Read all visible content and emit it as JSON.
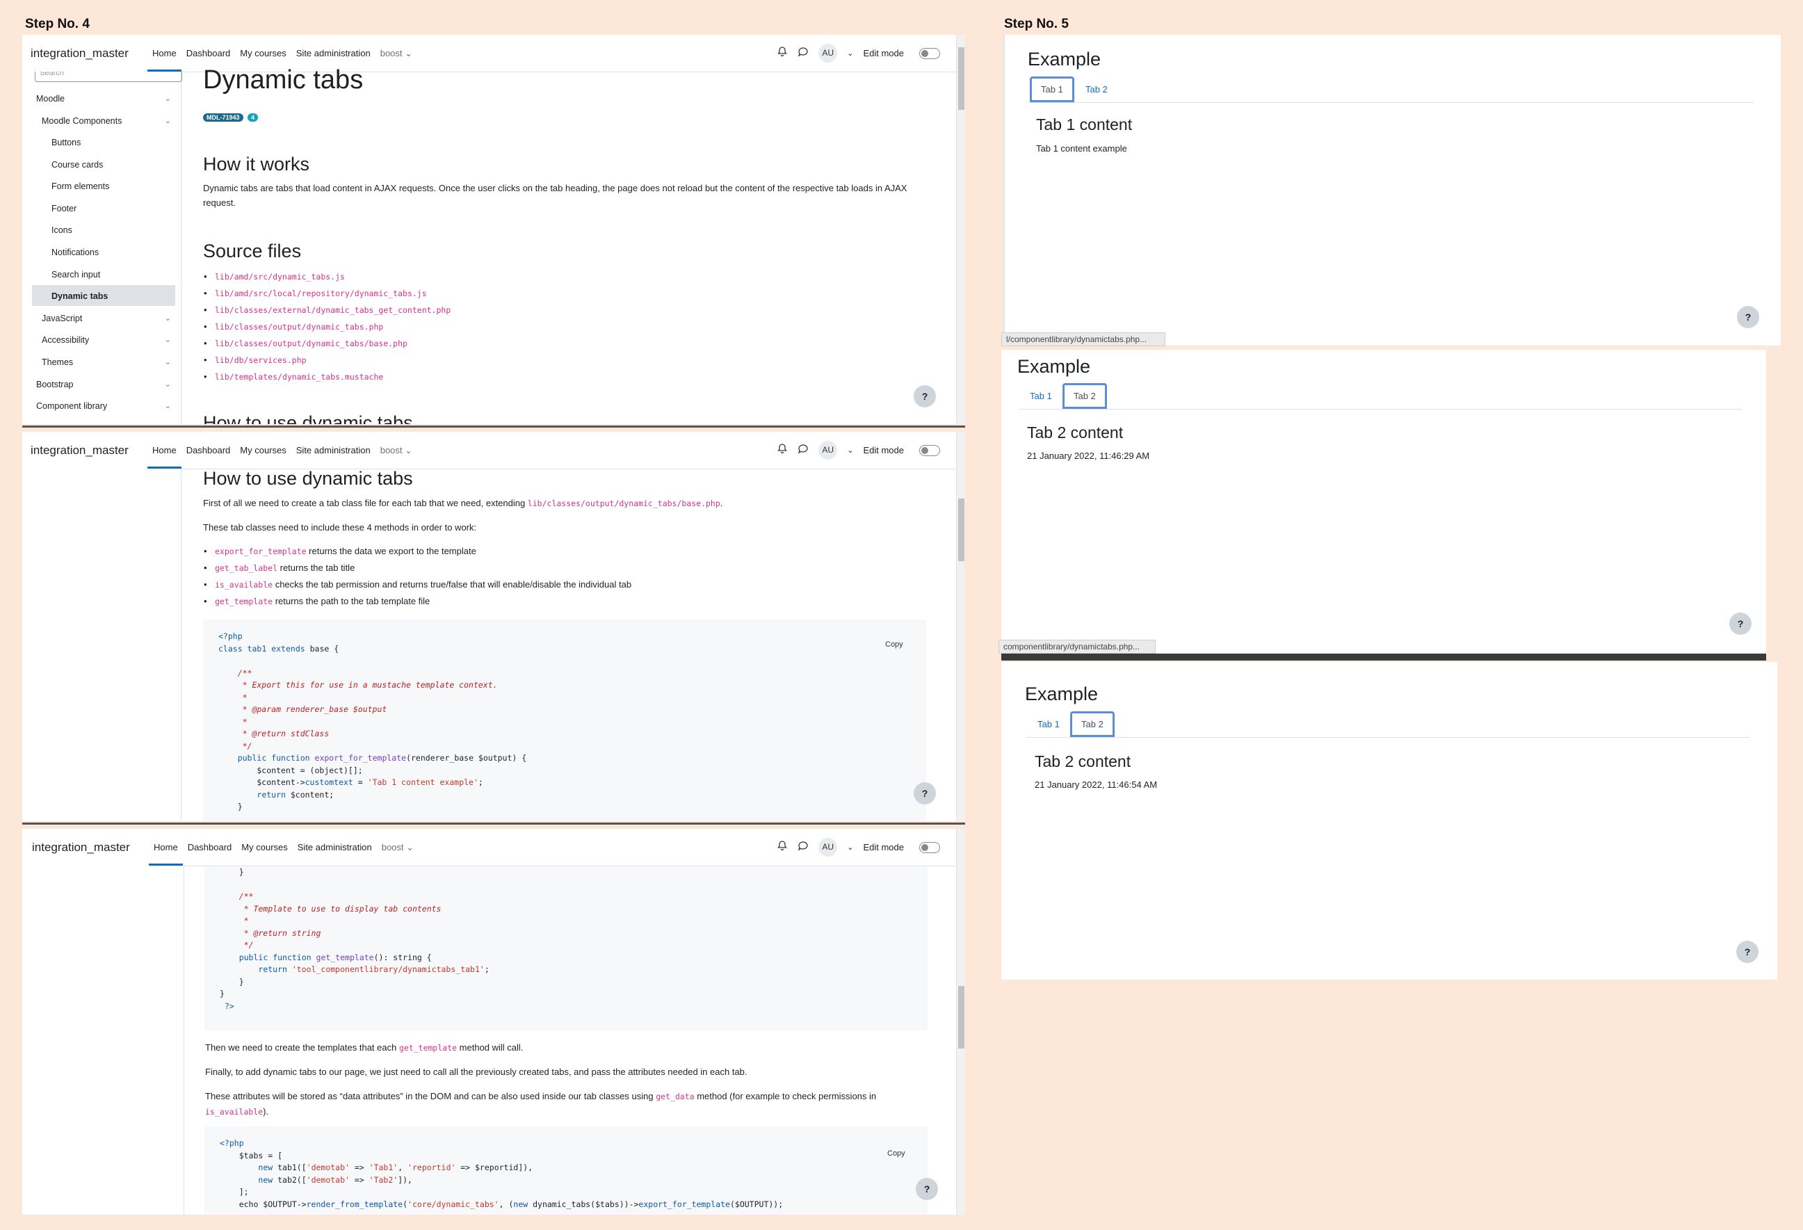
{
  "steps": {
    "step4": "Step No. 4",
    "step5": "Step No. 5"
  },
  "navbar": {
    "brand": "integration_master",
    "home": "Home",
    "dashboard": "Dashboard",
    "mycourses": "My courses",
    "siteadmin": "Site administration",
    "theme": "boost",
    "avatar": "AU",
    "editmode": "Edit mode"
  },
  "sidebar": {
    "search_placeholder": "Search",
    "items": [
      {
        "label": "Moodle"
      },
      {
        "label": "Moodle Components"
      },
      {
        "label": "Buttons"
      },
      {
        "label": "Course cards"
      },
      {
        "label": "Form elements"
      },
      {
        "label": "Footer"
      },
      {
        "label": "Icons"
      },
      {
        "label": "Notifications"
      },
      {
        "label": "Search input"
      },
      {
        "label": "Dynamic tabs"
      },
      {
        "label": "JavaScript"
      },
      {
        "label": "Accessibility"
      },
      {
        "label": "Themes"
      },
      {
        "label": "Bootstrap"
      },
      {
        "label": "Component library"
      }
    ]
  },
  "page1": {
    "title": "Dynamic tabs",
    "badge": "MDL-71943",
    "badge_count": "4",
    "how_title": "How it works",
    "how_text": "Dynamic tabs are tabs that load content in AJAX requests. Once the user clicks on the tab heading, the page does not reload but the content of the respective tab loads in AJAX request.",
    "source_title": "Source files",
    "files": [
      "lib/amd/src/dynamic_tabs.js",
      "lib/amd/src/local/repository/dynamic_tabs.js",
      "lib/classes/external/dynamic_tabs_get_content.php",
      "lib/classes/output/dynamic_tabs.php",
      "lib/classes/output/dynamic_tabs/base.php",
      "lib/db/services.php",
      "lib/templates/dynamic_tabs.mustache"
    ],
    "cut_heading": "How to use dynamic tabs"
  },
  "page2": {
    "title": "How to use dynamic tabs",
    "intro_pre": "First of all we need to create a tab class file for each tab that we need, extending ",
    "intro_code": "lib/classes/output/dynamic_tabs/base.php",
    "intro_post": ".",
    "methods_text": "These tab classes need to include these 4 methods in order to work:",
    "methods": [
      {
        "code": "export_for_template",
        "text": " returns the data we export to the template"
      },
      {
        "code": "get_tab_label",
        "text": " returns the tab title"
      },
      {
        "code": "is_available",
        "text": " checks the tab permission and returns true/false that will enable/disable the individual tab"
      },
      {
        "code": "get_template",
        "text": " returns the path to the tab template file"
      }
    ],
    "copy": "Copy"
  },
  "page3": {
    "then_pre": "Then we need to create the templates that each ",
    "then_code": "get_template",
    "then_post": " method will call.",
    "finally": "Finally, to add dynamic tabs to our page, we just need to call all the previously created tabs, and pass the attributes needed in each tab.",
    "attrs_pre": "These attributes will be stored as “data attributes” in the DOM and can be also used inside our tab classes using ",
    "attrs_code": "get_data",
    "attrs_mid": " method (for example to check permissions in",
    "attrs_code2": "is_available",
    "attrs_post": ").",
    "copy": "Copy"
  },
  "example1": {
    "title": "Example",
    "tab1": "Tab 1",
    "tab2": "Tab 2",
    "heading": "Tab 1 content",
    "text": "Tab 1 content example"
  },
  "example2": {
    "title": "Example",
    "tab1": "Tab 1",
    "tab2": "Tab 2",
    "heading": "Tab 2 content",
    "text": "21 January 2022, 11:46:29 AM",
    "url": "l/componentlibrary/dynamictabs.php..."
  },
  "example3": {
    "title": "Example",
    "tab1": "Tab 1",
    "tab2": "Tab 2",
    "heading": "Tab 2 content",
    "text": "21 January 2022, 11:46:54 AM",
    "url": "componentlibrary/dynamictabs.php..."
  },
  "help": "?",
  "colors": {
    "background": "#fce7d8",
    "accent": "#0f6cbf",
    "code": "#d63384",
    "selected_tab_border": "#5b8ed6"
  }
}
